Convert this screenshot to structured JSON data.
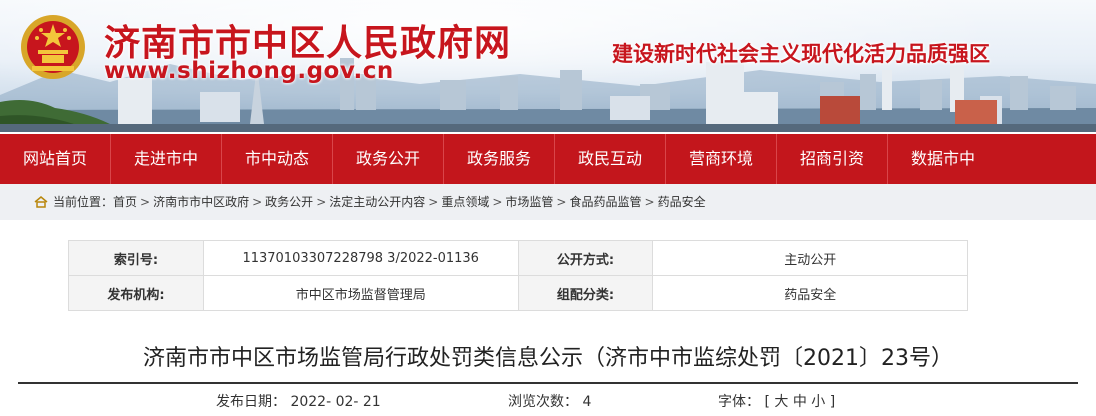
{
  "banner": {
    "site_title": "济南市市中区人民政府网",
    "site_url": "www.shizhong.gov.cn",
    "slogan": "建设新时代社会主义现代化活力品质强区"
  },
  "nav": {
    "items": [
      "网站首页",
      "走进市中",
      "市中动态",
      "政务公开",
      "政务服务",
      "政民互动",
      "营商环境",
      "招商引资",
      "数据市中"
    ]
  },
  "breadcrumb": {
    "prefix": "当前位置：",
    "items": [
      "首页",
      "济南市市中区政府",
      "政务公开",
      "法定主动公开内容",
      "重点领域",
      "市场监管",
      "食品药品监管",
      "药品安全"
    ],
    "separator": ">"
  },
  "info": {
    "index_label": "索引号:",
    "index_value": "11370103307228798 3/2022-01136",
    "method_label": "公开方式:",
    "method_value": "主动公开",
    "org_label": "发布机构:",
    "org_value": "市中区市场监督管理局",
    "category_label": "组配分类:",
    "category_value": "药品安全"
  },
  "article": {
    "title": "济南市市中区市场监管局行政处罚类信息公示（济市中市监综处罚〔2021〕23号）",
    "date_label": "发布日期：",
    "date_value": "2022- 02- 21",
    "views_label": "浏览次数：",
    "views_value": "4",
    "font_label": "字体：",
    "font_open": "[",
    "font_large": "大",
    "font_medium": "中",
    "font_small": "小",
    "font_close": "]"
  },
  "colors": {
    "brand_red": "#c3161c",
    "crumb_bg": "#eef0f3"
  }
}
